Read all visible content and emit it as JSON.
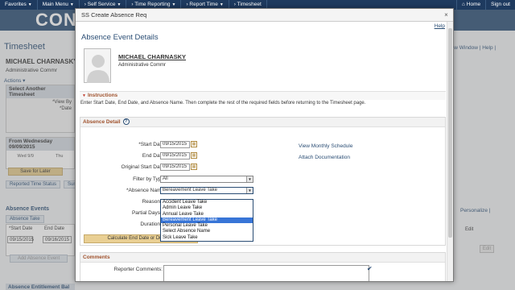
{
  "topnav": {
    "items": [
      "Favorites",
      "Main Menu",
      "Self Service",
      "Time Reporting",
      "Report Time",
      "Timesheet"
    ],
    "home": "Home",
    "signout": "Sign out"
  },
  "background": {
    "logo": "CONN",
    "title": "Timesheet",
    "employee_name": "MICHAEL CHARNASKY",
    "employee_title": "Administrative Commr",
    "actions": "Actions",
    "select_section": "Select Another Timesheet",
    "view_by": "*View By",
    "date": "*Date",
    "week_header": "From Wednesday 09/09/2015",
    "days": [
      "Wed 9/9",
      "Thu"
    ],
    "save_later": "Save for Later",
    "reported_tab": "Reported Time Status",
    "summary_tab": "Sum",
    "absence_events": "Absence Events",
    "absence_take_tab": "Absence Take",
    "start_date_col": "*Start Date",
    "end_date_col": "End Date",
    "start_val": "09/15/2015",
    "end_val": "09/16/2015",
    "add_event": "Add Absence Event",
    "entitlement": "Absence Entitlement Bal",
    "right_links": "New Window | Help |",
    "personalize": "Personalize |",
    "edit_col": "Edit",
    "edit_btn": "Edit"
  },
  "modal": {
    "title": "SS Create Absence Req",
    "help": "Help",
    "page_title": "Absence Event Details",
    "employee_name": "MICHAEL CHARNASKY",
    "employee_title": "Administrative Commr",
    "instructions_header": "Instructions",
    "instructions_text": "Enter Start Date, End Date, and Absence Name. Then complete the rest of the required fields before returning to the Timesheet page.",
    "detail_header": "Absence Detail",
    "labels": {
      "start_date": "*Start Date",
      "end_date": "End Date",
      "original_start": "Original Start Date",
      "filter_type": "Filter by Type",
      "absence_name": "*Absence Name",
      "reason": "Reason",
      "partial_days": "Partial Days",
      "duration": "Duration"
    },
    "values": {
      "start_date": "09/15/2015",
      "end_date": "09/15/2015",
      "original_start": "09/15/2015",
      "filter_type": "All",
      "absence_name": "Bereavement Leave Take"
    },
    "links": {
      "monthly_schedule": "View Monthly Schedule",
      "attach_doc": "Attach Documentation"
    },
    "dropdown_options": [
      "Accident Leave Take",
      "Admin Leave Take",
      "Annual Leave Take",
      "Bereavement Leave Take",
      "Personal Leave Take",
      "Select Absence Name",
      "Sick Leave Take"
    ],
    "selected_index": 3,
    "calc_button": "Calculate End Date or Duration",
    "comments_header": "Comments",
    "reporter_comments": "Reporter Comments:"
  }
}
